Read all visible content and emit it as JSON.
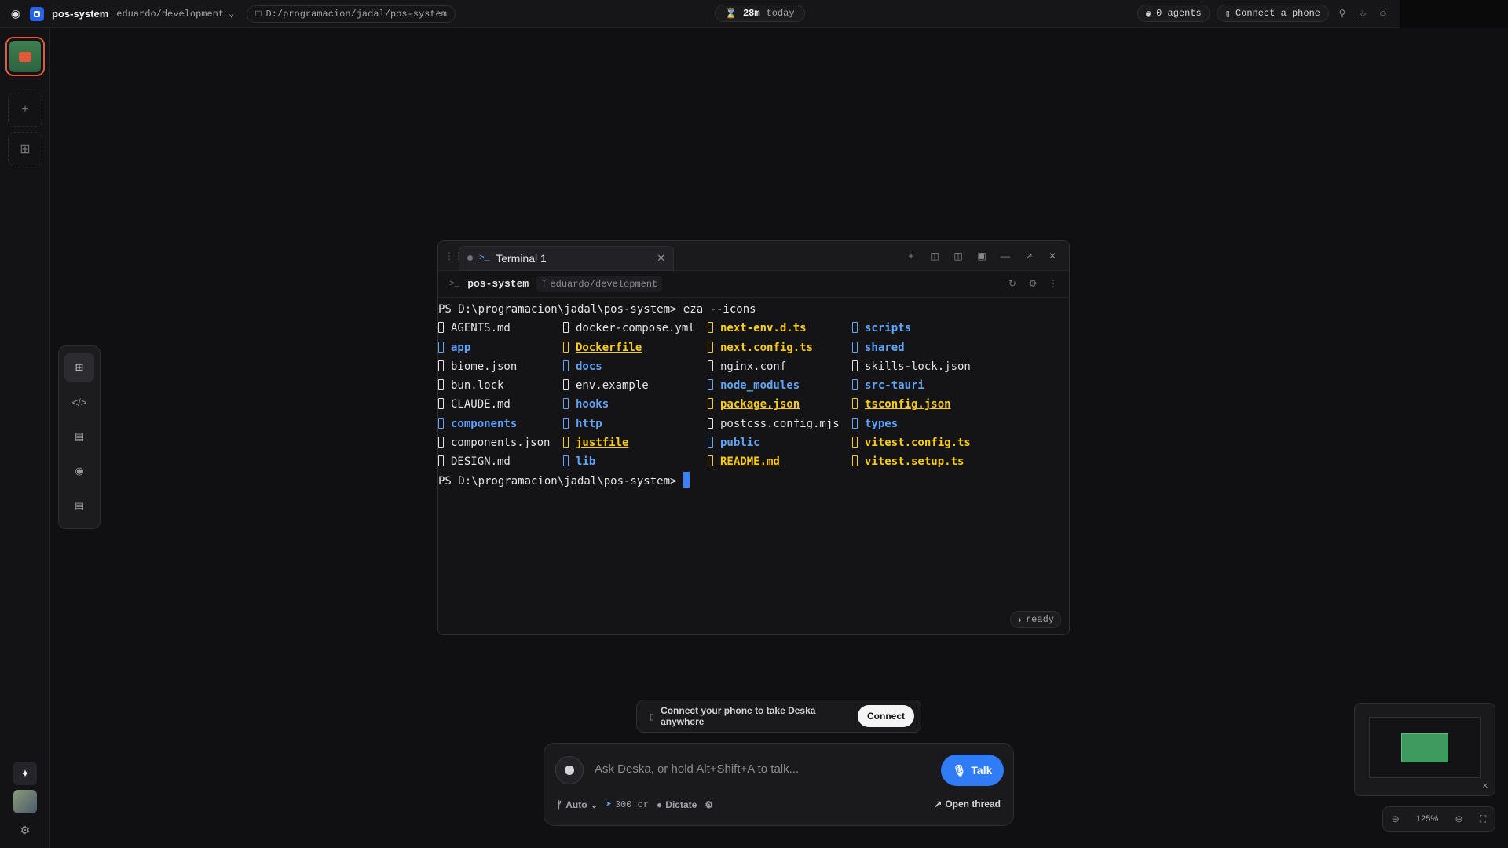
{
  "topbar": {
    "project_name": "pos-system",
    "branch": "eduardo/development",
    "path": "D:/programacion/jadal/pos-system",
    "time_value": "28m",
    "time_label": "today",
    "agents": "0 agents",
    "connect_phone": "Connect a phone"
  },
  "palette": {
    "items": [
      "grid-icon",
      "code-icon",
      "terminal-icon",
      "chrome-icon",
      "notes-icon"
    ]
  },
  "terminal": {
    "tab_title": "Terminal 1",
    "sub_name": "pos-system",
    "sub_branch": "eduardo/development",
    "command_line": "PS D:\\programacion\\jadal\\pos-system> eza --icons",
    "prompt_line": "PS D:\\programacion\\jadal\\pos-system> ",
    "status": "ready",
    "rows": [
      [
        {
          "t": "AGENTS.md",
          "k": "file"
        },
        {
          "t": "docker-compose.yml",
          "k": "file"
        },
        {
          "t": "next-env.d.ts",
          "k": "src"
        },
        {
          "t": "scripts",
          "k": "dir"
        }
      ],
      [
        {
          "t": "app",
          "k": "dir"
        },
        {
          "t": "Dockerfile",
          "k": "srcu"
        },
        {
          "t": "next.config.ts",
          "k": "src"
        },
        {
          "t": "shared",
          "k": "dir"
        }
      ],
      [
        {
          "t": "biome.json",
          "k": "file"
        },
        {
          "t": "docs",
          "k": "dir"
        },
        {
          "t": "nginx.conf",
          "k": "file"
        },
        {
          "t": "skills-lock.json",
          "k": "file"
        }
      ],
      [
        {
          "t": "bun.lock",
          "k": "file"
        },
        {
          "t": "env.example",
          "k": "file"
        },
        {
          "t": "node_modules",
          "k": "dir"
        },
        {
          "t": "src-tauri",
          "k": "dir"
        }
      ],
      [
        {
          "t": "CLAUDE.md",
          "k": "file"
        },
        {
          "t": "hooks",
          "k": "dir"
        },
        {
          "t": "package.json",
          "k": "srcu"
        },
        {
          "t": "tsconfig.json",
          "k": "srcu"
        }
      ],
      [
        {
          "t": "components",
          "k": "dir"
        },
        {
          "t": "http",
          "k": "dir"
        },
        {
          "t": "postcss.config.mjs",
          "k": "file"
        },
        {
          "t": "types",
          "k": "dir"
        }
      ],
      [
        {
          "t": "components.json",
          "k": "file"
        },
        {
          "t": "justfile",
          "k": "srcu"
        },
        {
          "t": "public",
          "k": "dir"
        },
        {
          "t": "vitest.config.ts",
          "k": "src"
        }
      ],
      [
        {
          "t": "DESIGN.md",
          "k": "file"
        },
        {
          "t": "lib",
          "k": "dir"
        },
        {
          "t": "README.md",
          "k": "srcu"
        },
        {
          "t": "vitest.setup.ts",
          "k": "src"
        }
      ]
    ]
  },
  "banner": {
    "text": "Connect your phone to take Deska anywhere",
    "button": "Connect"
  },
  "composer": {
    "placeholder": "Ask Deska, or hold Alt+Shift+A to talk...",
    "talk": "Talk",
    "mode": "Auto",
    "credits": "300 cr",
    "dictate": "Dictate",
    "open_thread": "Open thread"
  },
  "zoom": {
    "level": "125%"
  }
}
